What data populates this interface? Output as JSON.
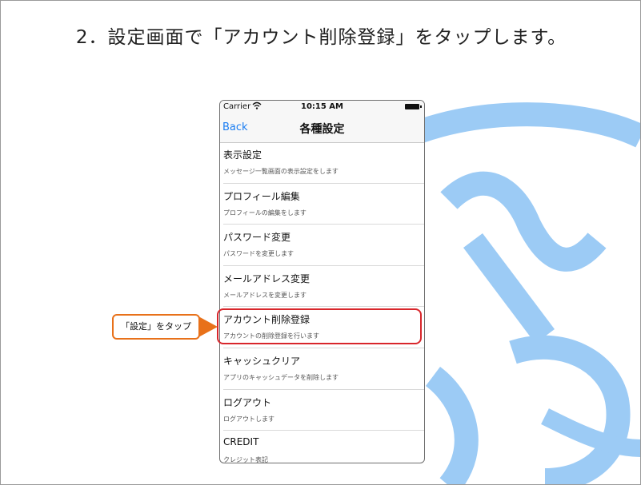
{
  "slide": {
    "title": "2．設定画面で「アカウント削除登録」をタップします。"
  },
  "colors": {
    "accent_blue": "#1a7df2",
    "highlight_red": "#d8262b",
    "callout_orange": "#e8711a",
    "deco_blue": "#9ccbf5"
  },
  "status_bar": {
    "carrier": "Carrier",
    "time": "10:15 AM",
    "wifi_icon": "wifi-icon",
    "battery_icon": "battery-icon"
  },
  "nav": {
    "back_label": "Back",
    "title": "各種設定"
  },
  "settings": [
    {
      "title": "表示設定",
      "subtitle": "メッセージ一覧画面の表示設定をします"
    },
    {
      "title": "プロフィール編集",
      "subtitle": "プロフィールの編集をします"
    },
    {
      "title": "パスワード変更",
      "subtitle": "パスワードを変更します"
    },
    {
      "title": "メールアドレス変更",
      "subtitle": "メールアドレスを変更します"
    },
    {
      "title": "アカウント削除登録",
      "subtitle": "アカウントの削除登録を行います"
    },
    {
      "title": "キャッシュクリア",
      "subtitle": "アプリのキャッシュデータを削除します"
    },
    {
      "title": "ログアウト",
      "subtitle": "ログアウトします"
    },
    {
      "title": "CREDIT",
      "subtitle": "クレジット表記"
    }
  ],
  "callout": {
    "label": "「設定」をタップ"
  }
}
